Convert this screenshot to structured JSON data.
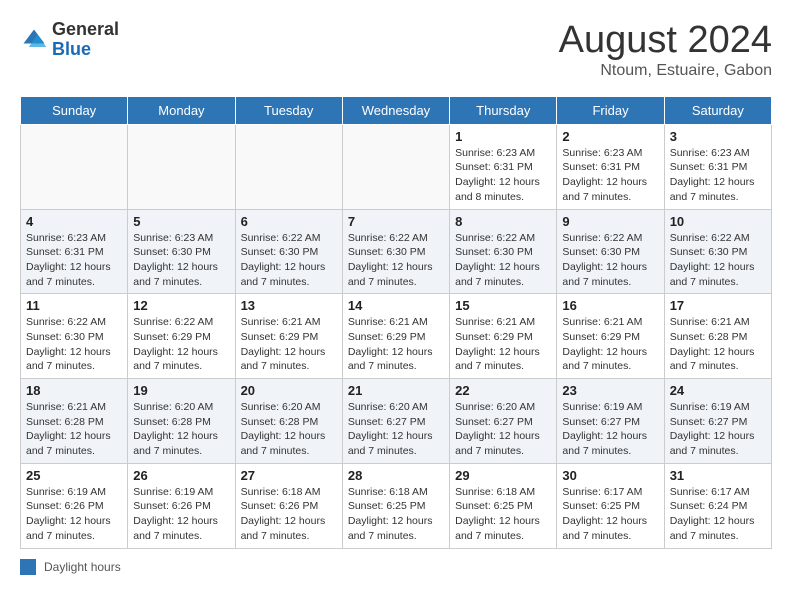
{
  "header": {
    "logo_general": "General",
    "logo_blue": "Blue",
    "month_year": "August 2024",
    "location": "Ntoum, Estuaire, Gabon"
  },
  "days_of_week": [
    "Sunday",
    "Monday",
    "Tuesday",
    "Wednesday",
    "Thursday",
    "Friday",
    "Saturday"
  ],
  "footer": {
    "label": "Daylight hours"
  },
  "weeks": [
    [
      {
        "day": "",
        "info": ""
      },
      {
        "day": "",
        "info": ""
      },
      {
        "day": "",
        "info": ""
      },
      {
        "day": "",
        "info": ""
      },
      {
        "day": "1",
        "info": "Sunrise: 6:23 AM\nSunset: 6:31 PM\nDaylight: 12 hours and 8 minutes."
      },
      {
        "day": "2",
        "info": "Sunrise: 6:23 AM\nSunset: 6:31 PM\nDaylight: 12 hours and 7 minutes."
      },
      {
        "day": "3",
        "info": "Sunrise: 6:23 AM\nSunset: 6:31 PM\nDaylight: 12 hours and 7 minutes."
      }
    ],
    [
      {
        "day": "4",
        "info": "Sunrise: 6:23 AM\nSunset: 6:31 PM\nDaylight: 12 hours and 7 minutes."
      },
      {
        "day": "5",
        "info": "Sunrise: 6:23 AM\nSunset: 6:30 PM\nDaylight: 12 hours and 7 minutes."
      },
      {
        "day": "6",
        "info": "Sunrise: 6:22 AM\nSunset: 6:30 PM\nDaylight: 12 hours and 7 minutes."
      },
      {
        "day": "7",
        "info": "Sunrise: 6:22 AM\nSunset: 6:30 PM\nDaylight: 12 hours and 7 minutes."
      },
      {
        "day": "8",
        "info": "Sunrise: 6:22 AM\nSunset: 6:30 PM\nDaylight: 12 hours and 7 minutes."
      },
      {
        "day": "9",
        "info": "Sunrise: 6:22 AM\nSunset: 6:30 PM\nDaylight: 12 hours and 7 minutes."
      },
      {
        "day": "10",
        "info": "Sunrise: 6:22 AM\nSunset: 6:30 PM\nDaylight: 12 hours and 7 minutes."
      }
    ],
    [
      {
        "day": "11",
        "info": "Sunrise: 6:22 AM\nSunset: 6:30 PM\nDaylight: 12 hours and 7 minutes."
      },
      {
        "day": "12",
        "info": "Sunrise: 6:22 AM\nSunset: 6:29 PM\nDaylight: 12 hours and 7 minutes."
      },
      {
        "day": "13",
        "info": "Sunrise: 6:21 AM\nSunset: 6:29 PM\nDaylight: 12 hours and 7 minutes."
      },
      {
        "day": "14",
        "info": "Sunrise: 6:21 AM\nSunset: 6:29 PM\nDaylight: 12 hours and 7 minutes."
      },
      {
        "day": "15",
        "info": "Sunrise: 6:21 AM\nSunset: 6:29 PM\nDaylight: 12 hours and 7 minutes."
      },
      {
        "day": "16",
        "info": "Sunrise: 6:21 AM\nSunset: 6:29 PM\nDaylight: 12 hours and 7 minutes."
      },
      {
        "day": "17",
        "info": "Sunrise: 6:21 AM\nSunset: 6:28 PM\nDaylight: 12 hours and 7 minutes."
      }
    ],
    [
      {
        "day": "18",
        "info": "Sunrise: 6:21 AM\nSunset: 6:28 PM\nDaylight: 12 hours and 7 minutes."
      },
      {
        "day": "19",
        "info": "Sunrise: 6:20 AM\nSunset: 6:28 PM\nDaylight: 12 hours and 7 minutes."
      },
      {
        "day": "20",
        "info": "Sunrise: 6:20 AM\nSunset: 6:28 PM\nDaylight: 12 hours and 7 minutes."
      },
      {
        "day": "21",
        "info": "Sunrise: 6:20 AM\nSunset: 6:27 PM\nDaylight: 12 hours and 7 minutes."
      },
      {
        "day": "22",
        "info": "Sunrise: 6:20 AM\nSunset: 6:27 PM\nDaylight: 12 hours and 7 minutes."
      },
      {
        "day": "23",
        "info": "Sunrise: 6:19 AM\nSunset: 6:27 PM\nDaylight: 12 hours and 7 minutes."
      },
      {
        "day": "24",
        "info": "Sunrise: 6:19 AM\nSunset: 6:27 PM\nDaylight: 12 hours and 7 minutes."
      }
    ],
    [
      {
        "day": "25",
        "info": "Sunrise: 6:19 AM\nSunset: 6:26 PM\nDaylight: 12 hours and 7 minutes."
      },
      {
        "day": "26",
        "info": "Sunrise: 6:19 AM\nSunset: 6:26 PM\nDaylight: 12 hours and 7 minutes."
      },
      {
        "day": "27",
        "info": "Sunrise: 6:18 AM\nSunset: 6:26 PM\nDaylight: 12 hours and 7 minutes."
      },
      {
        "day": "28",
        "info": "Sunrise: 6:18 AM\nSunset: 6:25 PM\nDaylight: 12 hours and 7 minutes."
      },
      {
        "day": "29",
        "info": "Sunrise: 6:18 AM\nSunset: 6:25 PM\nDaylight: 12 hours and 7 minutes."
      },
      {
        "day": "30",
        "info": "Sunrise: 6:17 AM\nSunset: 6:25 PM\nDaylight: 12 hours and 7 minutes."
      },
      {
        "day": "31",
        "info": "Sunrise: 6:17 AM\nSunset: 6:24 PM\nDaylight: 12 hours and 7 minutes."
      }
    ]
  ]
}
